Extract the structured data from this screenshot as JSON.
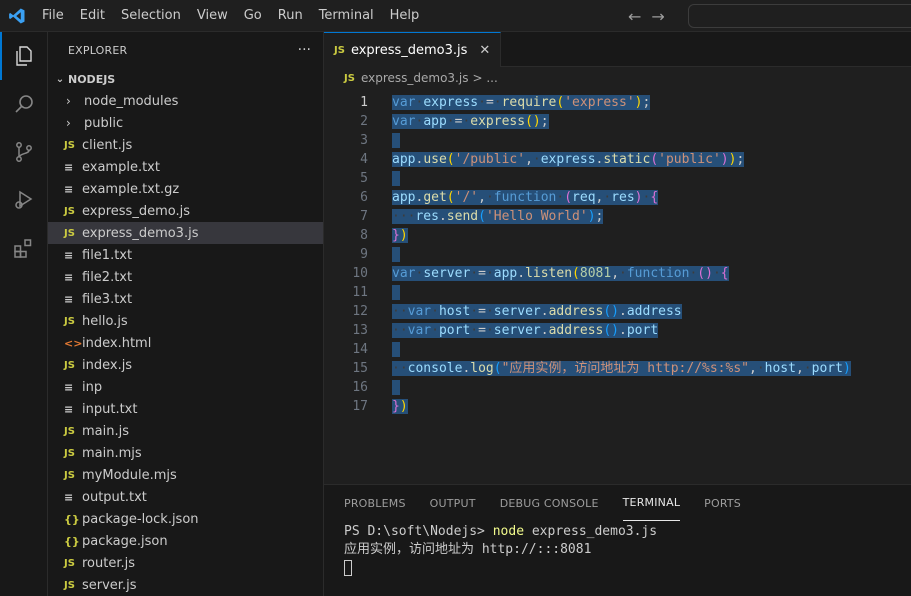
{
  "menu": [
    "File",
    "Edit",
    "Selection",
    "View",
    "Go",
    "Run",
    "Terminal",
    "Help"
  ],
  "sidebar": {
    "title": "EXPLORER",
    "more": "···",
    "folder": "NODEJS",
    "items": [
      {
        "name": "node_modules",
        "icon": "folder"
      },
      {
        "name": "public",
        "icon": "folder"
      },
      {
        "name": "client.js",
        "icon": "js"
      },
      {
        "name": "example.txt",
        "icon": "txt"
      },
      {
        "name": "example.txt.gz",
        "icon": "txt"
      },
      {
        "name": "express_demo.js",
        "icon": "js"
      },
      {
        "name": "express_demo3.js",
        "icon": "js",
        "selected": true
      },
      {
        "name": "file1.txt",
        "icon": "txt"
      },
      {
        "name": "file2.txt",
        "icon": "txt"
      },
      {
        "name": "file3.txt",
        "icon": "txt"
      },
      {
        "name": "hello.js",
        "icon": "js"
      },
      {
        "name": "index.html",
        "icon": "html"
      },
      {
        "name": "index.js",
        "icon": "js"
      },
      {
        "name": "inp",
        "icon": "txt"
      },
      {
        "name": "input.txt",
        "icon": "txt"
      },
      {
        "name": "main.js",
        "icon": "js"
      },
      {
        "name": "main.mjs",
        "icon": "js"
      },
      {
        "name": "myModule.mjs",
        "icon": "js"
      },
      {
        "name": "output.txt",
        "icon": "txt"
      },
      {
        "name": "package-lock.json",
        "icon": "json"
      },
      {
        "name": "package.json",
        "icon": "json"
      },
      {
        "name": "router.js",
        "icon": "js"
      },
      {
        "name": "server.js",
        "icon": "js"
      }
    ]
  },
  "editor": {
    "tab_label": "express_demo3.js",
    "tab_icon": "JS",
    "close": "✕",
    "breadcrumb_file": "express_demo3.js",
    "breadcrumb_rest": "> ...",
    "line_numbers": [
      "1",
      "2",
      "3",
      "4",
      "5",
      "6",
      "7",
      "8",
      "9",
      "10",
      "11",
      "12",
      "13",
      "14",
      "15",
      "16",
      "17"
    ]
  },
  "panel": {
    "tabs": [
      "PROBLEMS",
      "OUTPUT",
      "DEBUG CONSOLE",
      "TERMINAL",
      "PORTS"
    ],
    "active_tab": "TERMINAL",
    "prompt": "PS D:\\soft\\Nodejs> ",
    "command": "node",
    "command_arg": " express_demo3.js",
    "output": "应用实例，访问地址为 http://:::8081"
  },
  "colors": {
    "accent": "#0078d4",
    "selection": "#264f78",
    "js_icon": "#cbcb41",
    "html_icon": "#e37933"
  }
}
